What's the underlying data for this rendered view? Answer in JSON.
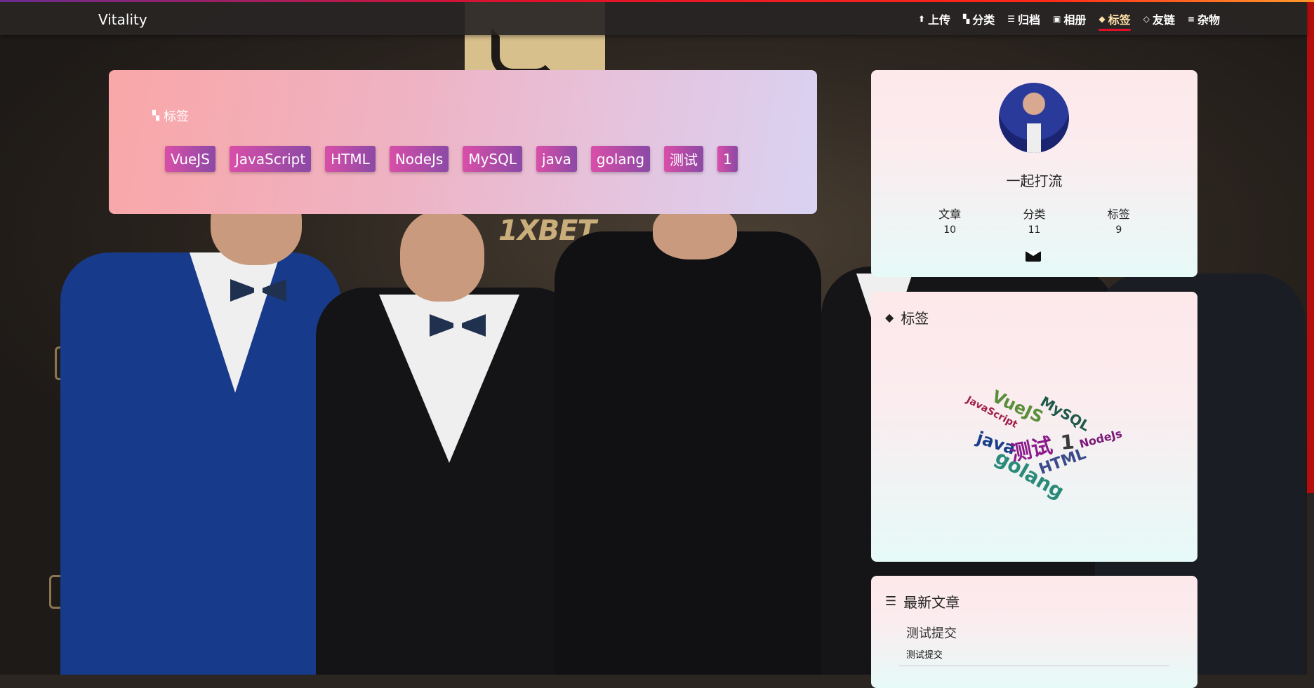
{
  "navbar": {
    "brand": "Vitality",
    "items": [
      {
        "label": "上传",
        "icon": "upload-icon",
        "glyph": "⬆"
      },
      {
        "label": "分类",
        "icon": "cubes-icon",
        "glyph": "▚"
      },
      {
        "label": "归档",
        "icon": "archive-icon",
        "glyph": "☰"
      },
      {
        "label": "相册",
        "icon": "image-icon",
        "glyph": "▣"
      },
      {
        "label": "标签",
        "icon": "tag-icon",
        "glyph": "◆",
        "active": true
      },
      {
        "label": "友链",
        "icon": "diamond-icon",
        "glyph": "◇"
      },
      {
        "label": "杂物",
        "icon": "list-icon",
        "glyph": "≡"
      }
    ]
  },
  "tag_panel": {
    "title": "标签",
    "tags": [
      "VueJS",
      "JavaScript",
      "HTML",
      "NodeJs",
      "MySQL",
      "java",
      "golang",
      "测试",
      "1"
    ]
  },
  "profile": {
    "name": "一起打流",
    "stats": [
      {
        "label": "文章",
        "value": "10"
      },
      {
        "label": "分类",
        "value": "11"
      },
      {
        "label": "标签",
        "value": "9"
      }
    ]
  },
  "tag_cloud": {
    "title": "标签",
    "words": [
      {
        "text": "VueJS",
        "color": "#5a8f3a"
      },
      {
        "text": "MySQL",
        "color": "#1f5a4a"
      },
      {
        "text": "JavaScript",
        "color": "#a0204a"
      },
      {
        "text": "java",
        "color": "#1a3f8a"
      },
      {
        "text": "测试",
        "color": "#8a1a8a"
      },
      {
        "text": "1",
        "color": "#3a3a3a"
      },
      {
        "text": "NodeJs",
        "color": "#7a1a7a"
      },
      {
        "text": "HTML",
        "color": "#3a4a8a"
      },
      {
        "text": "golang",
        "color": "#2a8a7a"
      }
    ]
  },
  "recent": {
    "title": "最新文章",
    "post_title": "测试提交",
    "post_excerpt": "测试提交"
  },
  "colors": {
    "accent": "#e0102a",
    "tag_chip_start": "#d94ea8",
    "tag_chip_end": "#8b4aa6"
  }
}
